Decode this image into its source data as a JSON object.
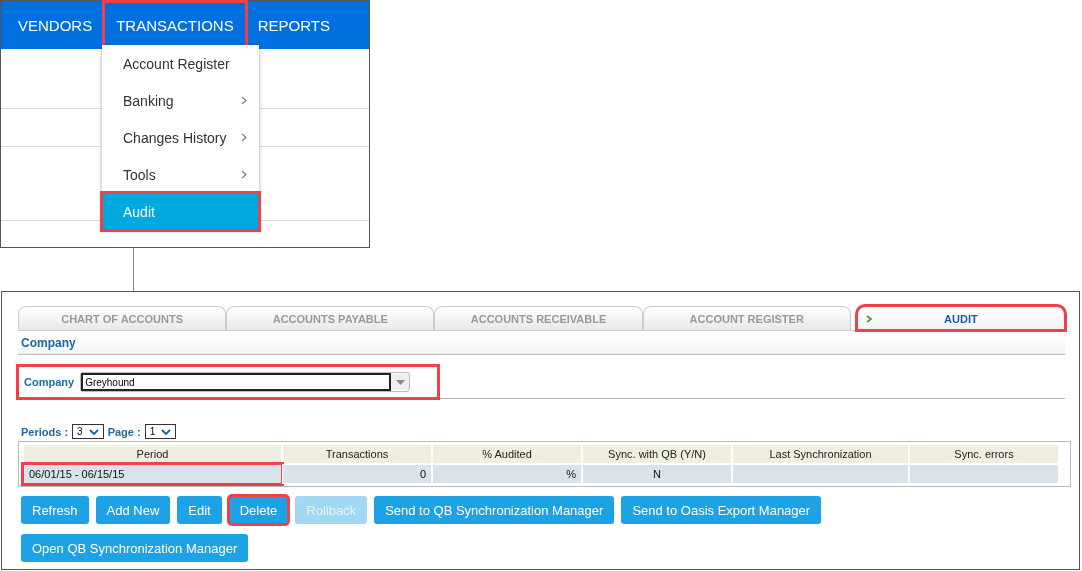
{
  "menu_bar": {
    "items": [
      {
        "label": "VENDORS",
        "highlighted": false
      },
      {
        "label": "TRANSACTIONS",
        "highlighted": true
      },
      {
        "label": "REPORTS",
        "highlighted": false
      }
    ]
  },
  "dropdown": {
    "items": [
      {
        "label": "Account Register",
        "submenu": false,
        "selected": false,
        "highlighted": false
      },
      {
        "label": "Banking",
        "submenu": true,
        "selected": false,
        "highlighted": false
      },
      {
        "label": "Changes History",
        "submenu": true,
        "selected": false,
        "highlighted": false
      },
      {
        "label": "Tools",
        "submenu": true,
        "selected": false,
        "highlighted": false
      },
      {
        "label": "Audit",
        "submenu": false,
        "selected": true,
        "highlighted": true
      }
    ]
  },
  "tabs": [
    {
      "label": "CHART OF ACCOUNTS",
      "selected": false,
      "highlighted": false
    },
    {
      "label": "ACCOUNTS PAYABLE",
      "selected": false,
      "highlighted": false
    },
    {
      "label": "ACCOUNTS RECEIVABLE",
      "selected": false,
      "highlighted": false
    },
    {
      "label": "ACCOUNT REGISTER",
      "selected": false,
      "highlighted": false
    },
    {
      "label": "AUDIT",
      "selected": true,
      "highlighted": true
    }
  ],
  "section_title": "Company",
  "company": {
    "label": "Company",
    "value": "Greyhound",
    "highlighted": true
  },
  "periods": {
    "label": "Periods :",
    "value": "3"
  },
  "page": {
    "label": "Page :",
    "value": "1"
  },
  "table": {
    "columns": [
      "Period",
      "Transactions",
      "% Audited",
      "Sync. with QB (Y/N)",
      "Last Synchronization",
      "Sync. errors"
    ],
    "rows": [
      {
        "period": "06/01/15 - 06/15/15",
        "period_highlighted": true,
        "transactions": "0",
        "audited": "%",
        "sync": "N"
      }
    ]
  },
  "buttons": [
    {
      "label": "Refresh",
      "disabled": false,
      "highlighted": false
    },
    {
      "label": "Add New",
      "disabled": false,
      "highlighted": false
    },
    {
      "label": "Edit",
      "disabled": false,
      "highlighted": false
    },
    {
      "label": "Delete",
      "disabled": false,
      "highlighted": true
    },
    {
      "label": "Rollback",
      "disabled": true,
      "highlighted": false
    },
    {
      "label": "Send to QB Synchronization Manager",
      "disabled": false,
      "highlighted": false
    },
    {
      "label": "Send to Oasis Export Manager",
      "disabled": false,
      "highlighted": false
    },
    {
      "label": "Open QB Synchronization Manager",
      "disabled": false,
      "highlighted": false
    }
  ]
}
